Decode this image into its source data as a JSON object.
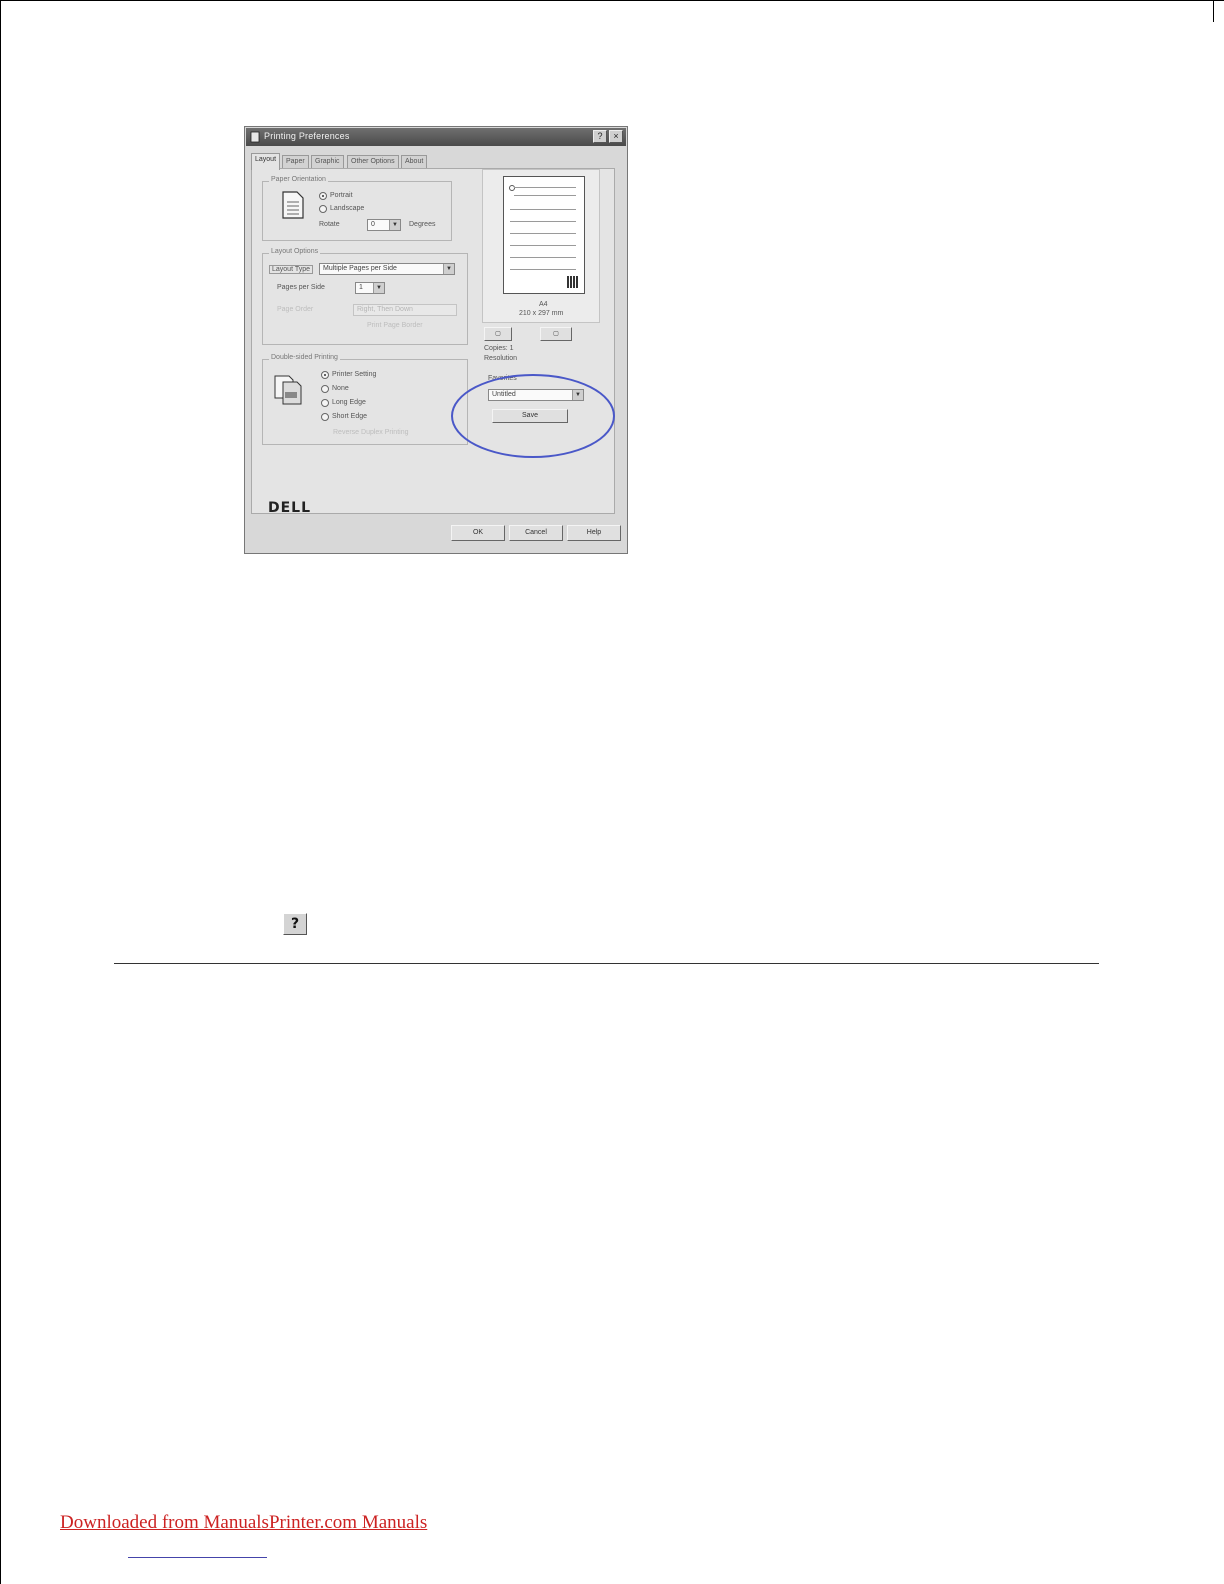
{
  "dialog": {
    "title": "Printing Preferences",
    "help_glyph": "?",
    "close_glyph": "×",
    "tabs": [
      {
        "label": "Layout"
      },
      {
        "label": "Paper"
      },
      {
        "label": "Graphic"
      },
      {
        "label": "Other Options"
      },
      {
        "label": "About"
      }
    ],
    "orientation": {
      "group_label": "Paper Orientation",
      "portrait": "Portrait",
      "landscape": "Landscape",
      "rotate_label": "Rotate",
      "rotate_value": "0",
      "degrees": "Degrees"
    },
    "layout": {
      "group_label": "Layout Options",
      "type_label": "Layout Type",
      "type_value": "Multiple Pages per Side",
      "pages_label": "Pages per Side",
      "pages_value": "1",
      "page_order_label": "Page Order",
      "page_order_value": "Right, Then Down",
      "print_border": "Print Page Border"
    },
    "duplex": {
      "group_label": "Double-sided Printing",
      "printer_setting": "Printer Setting",
      "none": "None",
      "long_edge": "Long Edge",
      "short_edge": "Short Edge",
      "reverse": "Reverse Duplex Printing"
    },
    "preview": {
      "size_name": "A4",
      "size_dims": "210 x 297 mm",
      "copies_label": "Copies: 1",
      "resolution_label": "Resolution"
    },
    "favorites": {
      "label": "Favorites",
      "value": "Untitled",
      "save_button": "Save"
    },
    "brand": "DELL",
    "ok": "OK",
    "cancel": "Cancel",
    "help": "Help"
  },
  "help_icon_glyph": "?",
  "footer": {
    "link_text": "Downloaded from ManualsPrinter.com Manuals"
  },
  "colors": {
    "highlight": "#4a58c8",
    "link": "#cc2222"
  }
}
